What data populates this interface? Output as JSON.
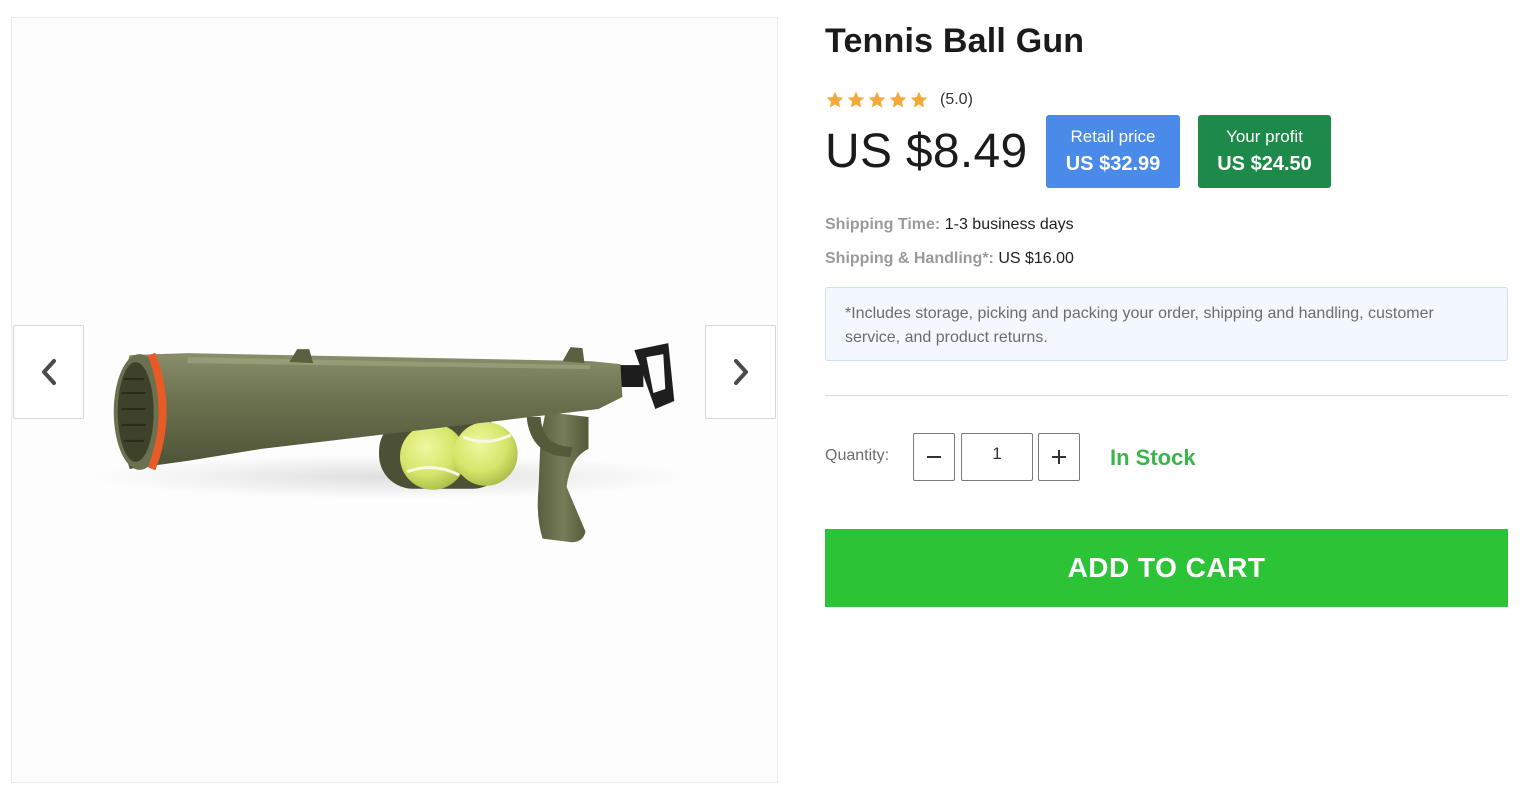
{
  "product": {
    "title": "Tennis Ball Gun",
    "rating": {
      "stars": 5,
      "max_stars": 5,
      "text": "(5.0)",
      "star_color": "#f4a83a"
    },
    "price": "US $8.49",
    "retail": {
      "label": "Retail price",
      "value": "US $32.99",
      "color": "#4a8ae8"
    },
    "profit": {
      "label": "Your profit",
      "value": "US $24.50",
      "color": "#1d8a4a"
    }
  },
  "shipping": {
    "time_label": "Shipping Time:",
    "time_value": "1-3 business days",
    "handling_label": "Shipping & Handling*:",
    "handling_value": "US $16.00",
    "note": "*Includes storage, picking and packing your order, shipping and handling, customer service, and product returns."
  },
  "quantity": {
    "label": "Quantity:",
    "value": "1",
    "minus_icon": "minus-icon",
    "plus_icon": "plus-icon"
  },
  "stock_status": "In Stock",
  "cart": {
    "label": "ADD TO CART",
    "color": "#2dc336"
  },
  "gallery": {
    "prev_icon": "chevron-left-icon",
    "next_icon": "chevron-right-icon",
    "image_subject": "tennis-ball-launcher"
  }
}
